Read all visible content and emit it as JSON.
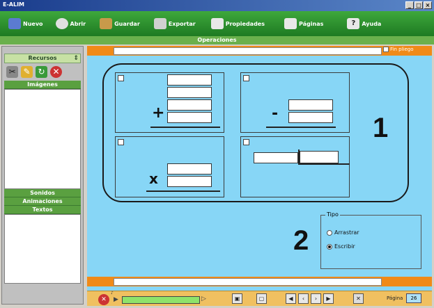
{
  "window": {
    "title": "E-ALIM"
  },
  "toolbar": {
    "items": [
      {
        "label": "Nuevo",
        "icon": "new-icon",
        "color": "#5b7bd0"
      },
      {
        "label": "Abrir",
        "icon": "open-icon",
        "color": "#e0e0e0"
      },
      {
        "label": "Guardar",
        "icon": "save-icon",
        "color": "#c89a4a"
      },
      {
        "label": "Exportar",
        "icon": "export-icon",
        "color": "#d0d0d0"
      },
      {
        "label": "Propiedades",
        "icon": "properties-icon",
        "color": "#e8e8e8"
      },
      {
        "label": "Páginas",
        "icon": "pages-icon",
        "color": "#e8e8e8"
      },
      {
        "label": "Ayuda",
        "icon": "help-icon",
        "color": "#e8e8e8"
      }
    ]
  },
  "section": {
    "title": "Operaciones"
  },
  "sidebar": {
    "header": "Recursos",
    "images_label": "Imágenes",
    "sections": [
      "Sonidos",
      "Animaciones",
      "Textos"
    ]
  },
  "main": {
    "fin_label": "Fin pliego",
    "big_labels": [
      "1",
      "2"
    ],
    "operators": [
      "+",
      "-",
      "x"
    ],
    "tipo": {
      "legend": "Tipo",
      "options": [
        {
          "label": "Arrastrar",
          "selected": false
        },
        {
          "label": "Escribir",
          "selected": true
        }
      ]
    }
  },
  "navigator": {
    "page_label": "Página",
    "page_value": "26"
  }
}
